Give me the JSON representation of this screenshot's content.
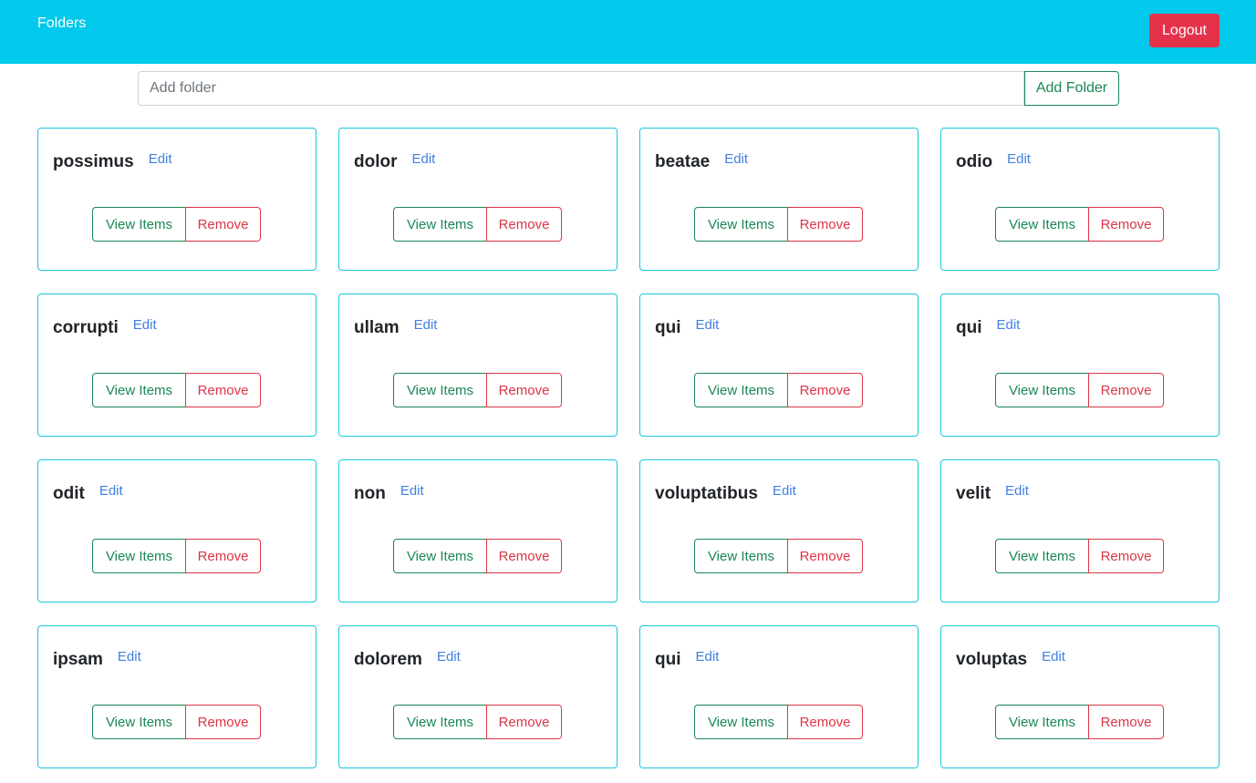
{
  "navbar": {
    "brand": "Folders",
    "logout_label": "Logout",
    "bg_color": "#00c9eb"
  },
  "add_folder": {
    "placeholder": "Add folder",
    "value": "",
    "button_label": "Add Folder"
  },
  "card_actions": {
    "edit_label": "Edit",
    "view_label": "View Items",
    "remove_label": "Remove"
  },
  "folders": [
    {
      "name": "possimus"
    },
    {
      "name": "dolor"
    },
    {
      "name": "beatae"
    },
    {
      "name": "odio"
    },
    {
      "name": "corrupti"
    },
    {
      "name": "ullam"
    },
    {
      "name": "qui"
    },
    {
      "name": "qui"
    },
    {
      "name": "odit"
    },
    {
      "name": "non"
    },
    {
      "name": "voluptatibus"
    },
    {
      "name": "velit"
    },
    {
      "name": "ipsam"
    },
    {
      "name": "dolorem"
    },
    {
      "name": "qui"
    },
    {
      "name": "voluptas"
    }
  ],
  "colors": {
    "accent": "#00c9eb",
    "card_border": "#17c6df",
    "success": "#198754",
    "danger": "#dc3545",
    "logout": "#e5324b",
    "link": "#3f7fe0"
  }
}
